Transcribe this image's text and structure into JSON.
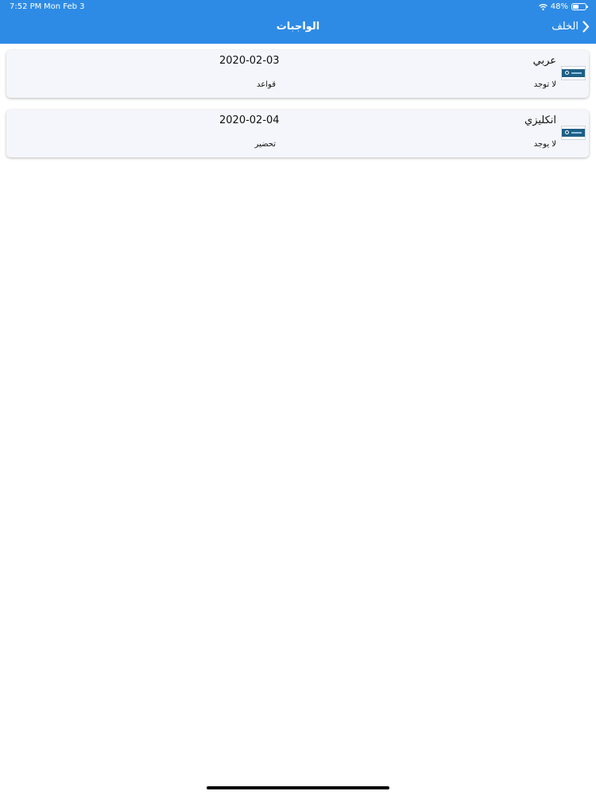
{
  "status_bar": {
    "time": "7:52 PM",
    "date": "Mon Feb 3",
    "battery_text": "48%",
    "battery_level": 0.48
  },
  "nav": {
    "title": "الواجبات",
    "back_label": "الخلف"
  },
  "homework": [
    {
      "subject": "عربي",
      "date": "2020-02-03",
      "attachment": "لا توجد",
      "type": "قواعد"
    },
    {
      "subject": "انكليزي",
      "date": "2020-02-04",
      "attachment": "لا يوجد",
      "type": "تحضير"
    }
  ],
  "colors": {
    "nav_bar": "#2d8be6",
    "card_background": "#f5f6fb",
    "thumbnail_band": "#1e5f86"
  }
}
